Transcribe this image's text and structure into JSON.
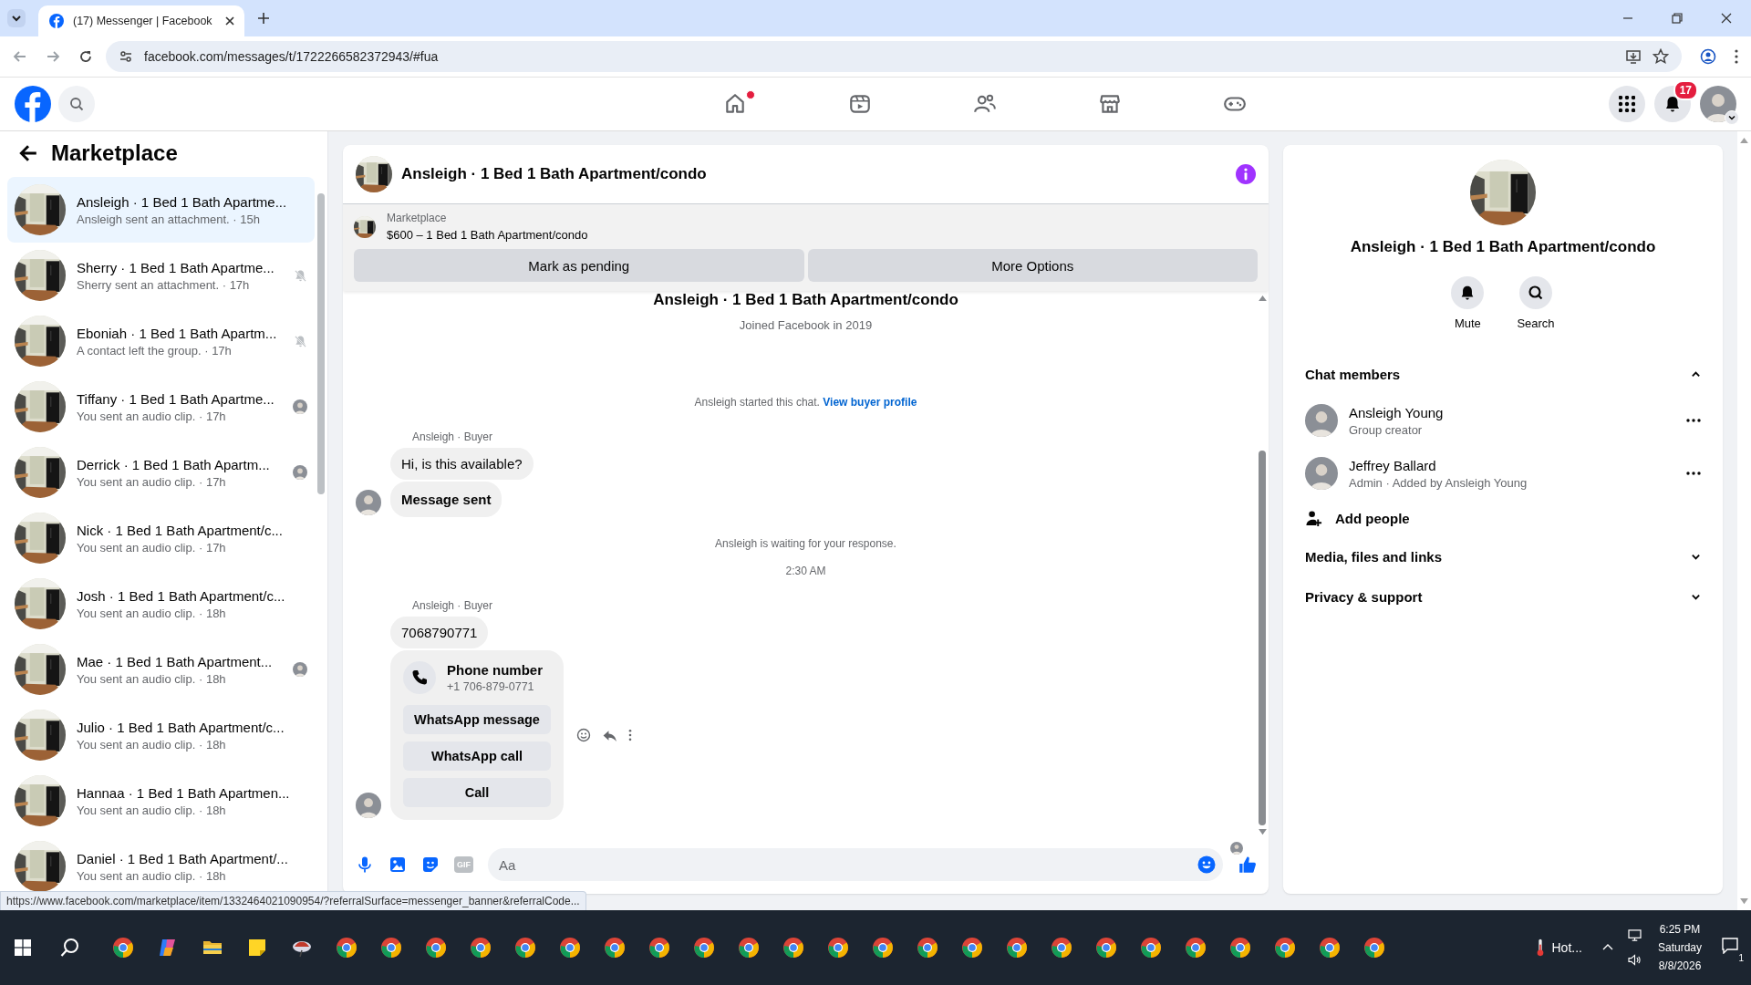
{
  "browser": {
    "tab_title": "(17) Messenger | Facebook",
    "url": "facebook.com/messages/t/1722266582372943/#fua",
    "status_url": "https://www.facebook.com/marketplace/item/1332464021090954/?referralSurface=messenger_banner&referralCode..."
  },
  "top_nav": {
    "items": [
      {
        "kind": "home",
        "notification": true
      },
      {
        "kind": "video",
        "notification": false
      },
      {
        "kind": "friends",
        "notification": false
      },
      {
        "kind": "marketplace",
        "notification": false
      },
      {
        "kind": "gaming",
        "notification": false
      }
    ],
    "notification_count": "17"
  },
  "sidebar": {
    "title": "Marketplace",
    "conversations": [
      {
        "name": "Ansleigh · 1 Bed 1 Bath Apartme...",
        "preview": "Ansleigh sent an attachment. · 15h",
        "selected": true,
        "muted": false,
        "seen": false
      },
      {
        "name": "Sherry · 1 Bed 1 Bath Apartme...",
        "preview": "Sherry sent an attachment. · 17h",
        "selected": false,
        "muted": true,
        "seen": false
      },
      {
        "name": "Eboniah · 1 Bed 1 Bath Apartm...",
        "preview": "A contact left the group. · 17h",
        "selected": false,
        "muted": true,
        "seen": false
      },
      {
        "name": "Tiffany · 1 Bed 1 Bath Apartme...",
        "preview": "You sent an audio clip. · 17h",
        "selected": false,
        "muted": false,
        "seen": true
      },
      {
        "name": "Derrick · 1 Bed 1 Bath Apartm...",
        "preview": "You sent an audio clip. · 17h",
        "selected": false,
        "muted": false,
        "seen": true
      },
      {
        "name": "Nick · 1 Bed 1 Bath Apartment/c...",
        "preview": "You sent an audio clip. · 17h",
        "selected": false,
        "muted": false,
        "seen": false
      },
      {
        "name": "Josh · 1 Bed 1 Bath Apartment/c...",
        "preview": "You sent an audio clip. · 18h",
        "selected": false,
        "muted": false,
        "seen": false
      },
      {
        "name": "Mae · 1 Bed 1 Bath Apartment...",
        "preview": "You sent an audio clip. · 18h",
        "selected": false,
        "muted": false,
        "seen": true
      },
      {
        "name": "Julio · 1 Bed 1 Bath Apartment/c...",
        "preview": "You sent an audio clip. · 18h",
        "selected": false,
        "muted": false,
        "seen": false
      },
      {
        "name": "Hannaa · 1 Bed 1 Bath Apartmen...",
        "preview": "You sent an audio clip. · 18h",
        "selected": false,
        "muted": false,
        "seen": false
      },
      {
        "name": "Daniel · 1 Bed 1 Bath Apartment/...",
        "preview": "You sent an audio clip. · 18h",
        "selected": false,
        "muted": false,
        "seen": false
      }
    ]
  },
  "chat": {
    "title": "Ansleigh · 1 Bed 1 Bath Apartment/condo",
    "listing": {
      "source": "Marketplace",
      "title": "$600 – 1 Bed 1 Bath Apartment/condo",
      "buttons": [
        "Mark as pending",
        "More Options"
      ]
    },
    "intro": {
      "title": "Ansleigh · 1 Bed 1 Bath Apartment/condo",
      "subtitle": "Joined Facebook in 2019"
    },
    "thread": [
      {
        "kind": "notice",
        "text": "Ansleigh started this chat.",
        "link": "View buyer profile"
      },
      {
        "kind": "group",
        "sender": "Ansleigh · Buyer",
        "bubbles": [
          {
            "kind": "text",
            "text": "Hi, is this available?"
          },
          {
            "kind": "status",
            "text": "Message sent"
          }
        ]
      },
      {
        "kind": "notice",
        "text": "Ansleigh is waiting for your response."
      },
      {
        "kind": "time",
        "text": "2:30 AM"
      },
      {
        "kind": "group",
        "sender": "Ansleigh · Buyer",
        "bubbles": [
          {
            "kind": "text",
            "text": "7068790771"
          },
          {
            "kind": "phone_card",
            "title": "Phone number",
            "number": "+1 706-879-0771",
            "buttons": [
              "WhatsApp message",
              "WhatsApp call",
              "Call"
            ]
          }
        ]
      }
    ],
    "composer": {
      "placeholder": "Aa",
      "gif_label": "GIF"
    }
  },
  "right_panel": {
    "title": "Ansleigh · 1 Bed 1 Bath Apartment/condo",
    "actions": [
      {
        "kind": "mute",
        "label": "Mute"
      },
      {
        "kind": "search",
        "label": "Search"
      }
    ],
    "sections": [
      {
        "title": "Chat members",
        "expanded": true,
        "members": [
          {
            "name": "Ansleigh Young",
            "role": "Group creator"
          },
          {
            "name": "Jeffrey Ballard",
            "role": "Admin · Added by Ansleigh Young"
          }
        ],
        "add_label": "Add people"
      },
      {
        "title": "Media, files and links",
        "expanded": false
      },
      {
        "title": "Privacy & support",
        "expanded": false
      }
    ]
  },
  "taskbar": {
    "weather": "Hot...",
    "time": "6:25 PM",
    "day": "Saturday",
    "date": "8/8/2026",
    "notification_count": "1"
  }
}
